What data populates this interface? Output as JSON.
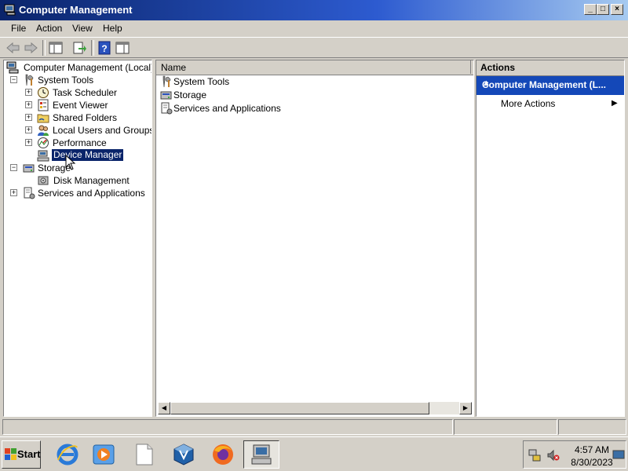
{
  "window": {
    "title": "Computer Management",
    "controls": {
      "minimize": "_",
      "maximize": "□",
      "close": "×"
    }
  },
  "menu": [
    "File",
    "Action",
    "View",
    "Help"
  ],
  "toolbar": {
    "buttons": [
      "back-arrow-icon",
      "forward-arrow-icon",
      "show-hide-console-tree-icon",
      "export-list-icon",
      "help-icon",
      "properties-icon"
    ]
  },
  "tree": {
    "root": {
      "label": "Computer Management (Local)",
      "icon": "computer-management-icon"
    },
    "items": [
      {
        "label": "System Tools",
        "expander": "−",
        "icon": "tools-icon"
      },
      {
        "label": "Task Scheduler",
        "expander": "+",
        "icon": "clock-icon"
      },
      {
        "label": "Event Viewer",
        "expander": "+",
        "icon": "event-viewer-icon"
      },
      {
        "label": "Shared Folders",
        "expander": "+",
        "icon": "shared-folder-icon"
      },
      {
        "label": "Local Users and Groups",
        "expander": "+",
        "icon": "users-icon"
      },
      {
        "label": "Performance",
        "expander": "+",
        "icon": "performance-icon"
      },
      {
        "label": "Device Manager",
        "expander": "",
        "icon": "device-manager-icon",
        "selected": true
      },
      {
        "label": "Storage",
        "expander": "−",
        "icon": "storage-icon"
      },
      {
        "label": "Disk Management",
        "expander": "",
        "icon": "disk-icon"
      },
      {
        "label": "Services and Applications",
        "expander": "+",
        "icon": "services-icon"
      }
    ]
  },
  "list": {
    "column_header": "Name",
    "items": [
      {
        "label": "System Tools",
        "icon": "tools-icon"
      },
      {
        "label": "Storage",
        "icon": "storage-icon"
      },
      {
        "label": "Services and Applications",
        "icon": "services-icon"
      }
    ]
  },
  "actions": {
    "header": "Actions",
    "group": "Computer Management (L...",
    "group_arrow": "▲",
    "items": [
      {
        "label": "More Actions",
        "arrow": "▶"
      }
    ]
  },
  "taskbar": {
    "start_label": "Start",
    "apps": [
      "internet-explorer-icon",
      "media-player-icon",
      "blank-document-icon",
      "virtualbox-icon",
      "firefox-icon",
      "computer-management-icon"
    ],
    "tray_icons": [
      "network-icon",
      "volume-muted-icon"
    ],
    "time": "4:57 AM",
    "date": "8/30/2023"
  },
  "colors": {
    "title_bar": "#0a246a",
    "selection": "#0a246a",
    "action_group": "#1448b8",
    "window_face": "#d4d0c8"
  }
}
